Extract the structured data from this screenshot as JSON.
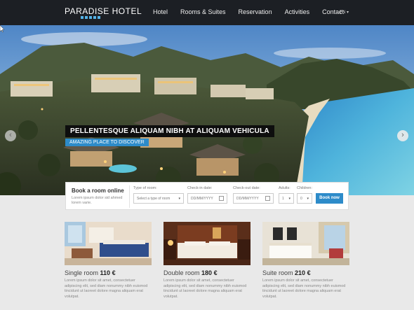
{
  "brand": {
    "name": "PARADISE HOTEL",
    "accent": "#2d8bc9"
  },
  "nav": {
    "items": [
      {
        "label": "Hotel"
      },
      {
        "label": "Rooms & Suites"
      },
      {
        "label": "Reservation"
      },
      {
        "label": "Activities"
      },
      {
        "label": "Contact"
      }
    ],
    "language": "EN ▾"
  },
  "hero": {
    "title": "PELLENTESQUE ALIQUAM NIBH AT ALIQUAM VEHICULA",
    "subtitle": "AMAZING PLACE TO DISCOVER",
    "prev_icon": "chevron-left-icon",
    "next_icon": "chevron-right-icon"
  },
  "booking": {
    "title": "Book a room online",
    "description": "Lorem ipsum dolor sid ahmed lorem varie.",
    "type_label": "Type of room:",
    "type_value": "Select a type of room",
    "checkin_label": "Check-in date:",
    "checkin_value": "DD/MM/YYYY",
    "checkout_label": "Check-out date:",
    "checkout_value": "DD/MM/YYYY",
    "adults_label": "Adults:",
    "adults_value": "1",
    "children_label": "Children:",
    "children_value": "0",
    "button": "Book now"
  },
  "rooms": [
    {
      "name": "Single room",
      "price": "110 €",
      "description": "Lorem ipsum dolor sit amet, consectetuer adipiscing elit, sed diam nonummy nibh euismod tincidunt ut laoreet dolore magna aliquam erat volutpat."
    },
    {
      "name": "Double room",
      "price": "180 €",
      "description": "Lorem ipsum dolor sit amet, consectetuer adipiscing elit, sed diam nonummy nibh euismod tincidunt ut laoreet dolore magna aliquam erat volutpat."
    },
    {
      "name": "Suite room",
      "price": "210 €",
      "description": "Lorem ipsum dolor sit amet, consectetuer adipiscing elit, sed diam nonummy nibh euismod tincidunt ut laoreet dolore magna aliquam erat volutpat."
    }
  ]
}
